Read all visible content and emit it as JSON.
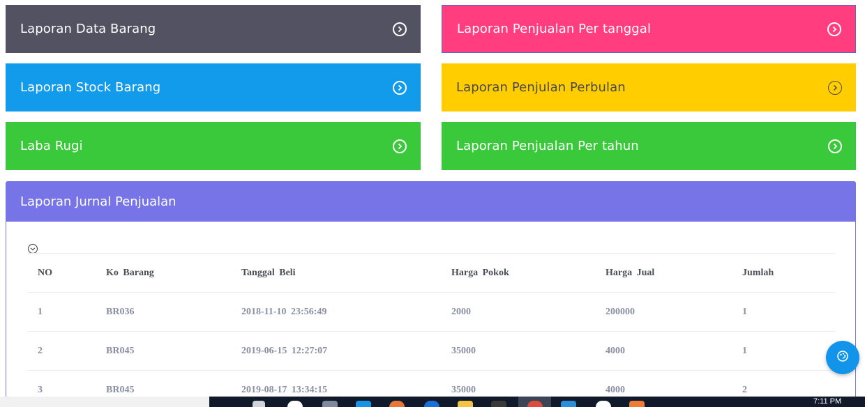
{
  "cards": [
    {
      "label": "Laporan Data Barang",
      "color": "#535263"
    },
    {
      "label": "Laporan Penjualan Per tanggal",
      "color": "#ff3d7f"
    },
    {
      "label": "Laporan Stock Barang",
      "color": "#129aeb"
    },
    {
      "label": "Laporan Penjulan Perbulan",
      "color": "#ffcd00"
    },
    {
      "label": "Laba Rugi",
      "color": "#3ac93a"
    },
    {
      "label": "Laporan Penjualan Per tahun",
      "color": "#3ac93a"
    }
  ],
  "panel": {
    "title": "Laporan Jurnal Penjualan",
    "header_color": "#7774e7"
  },
  "table": {
    "columns": [
      "NO",
      "Ko Barang",
      "Tanggal Beli",
      "Harga Pokok",
      "Harga Jual",
      "Jumlah"
    ],
    "rows": [
      [
        "1",
        "BR036",
        "2018-11-10 23:56:49",
        "2000",
        "200000",
        "1"
      ],
      [
        "2",
        "BR045",
        "2019-06-15 12:27:07",
        "35000",
        "4000",
        "1"
      ],
      [
        "3",
        "BR045",
        "2019-08-17 13:34:15",
        "35000",
        "4000",
        "2"
      ]
    ]
  },
  "icons": {
    "card_arrow": "chevron-circle-right-icon",
    "collapse": "chevron-circle-down-icon",
    "fab": "palette-icon"
  },
  "taskbar": {
    "clock": "7:11 PM"
  }
}
